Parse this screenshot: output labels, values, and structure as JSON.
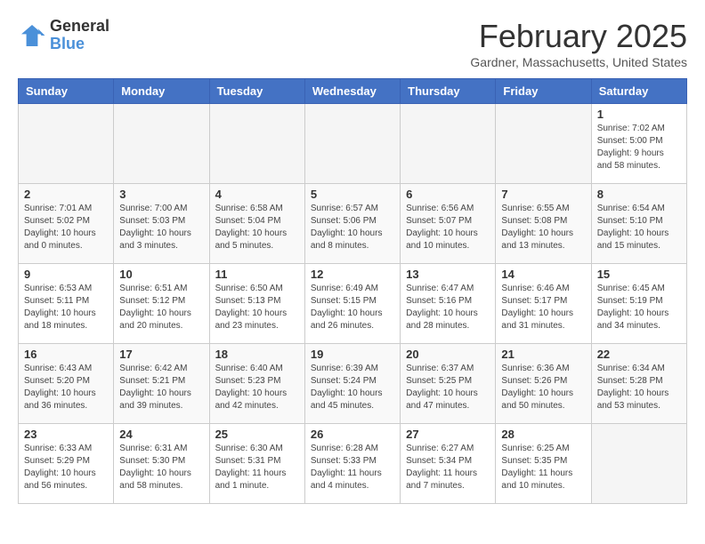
{
  "header": {
    "logo_general": "General",
    "logo_blue": "Blue",
    "title": "February 2025",
    "subtitle": "Gardner, Massachusetts, United States"
  },
  "weekdays": [
    "Sunday",
    "Monday",
    "Tuesday",
    "Wednesday",
    "Thursday",
    "Friday",
    "Saturday"
  ],
  "weeks": [
    [
      {
        "day": "",
        "info": ""
      },
      {
        "day": "",
        "info": ""
      },
      {
        "day": "",
        "info": ""
      },
      {
        "day": "",
        "info": ""
      },
      {
        "day": "",
        "info": ""
      },
      {
        "day": "",
        "info": ""
      },
      {
        "day": "1",
        "info": "Sunrise: 7:02 AM\nSunset: 5:00 PM\nDaylight: 9 hours\nand 58 minutes."
      }
    ],
    [
      {
        "day": "2",
        "info": "Sunrise: 7:01 AM\nSunset: 5:02 PM\nDaylight: 10 hours\nand 0 minutes."
      },
      {
        "day": "3",
        "info": "Sunrise: 7:00 AM\nSunset: 5:03 PM\nDaylight: 10 hours\nand 3 minutes."
      },
      {
        "day": "4",
        "info": "Sunrise: 6:58 AM\nSunset: 5:04 PM\nDaylight: 10 hours\nand 5 minutes."
      },
      {
        "day": "5",
        "info": "Sunrise: 6:57 AM\nSunset: 5:06 PM\nDaylight: 10 hours\nand 8 minutes."
      },
      {
        "day": "6",
        "info": "Sunrise: 6:56 AM\nSunset: 5:07 PM\nDaylight: 10 hours\nand 10 minutes."
      },
      {
        "day": "7",
        "info": "Sunrise: 6:55 AM\nSunset: 5:08 PM\nDaylight: 10 hours\nand 13 minutes."
      },
      {
        "day": "8",
        "info": "Sunrise: 6:54 AM\nSunset: 5:10 PM\nDaylight: 10 hours\nand 15 minutes."
      }
    ],
    [
      {
        "day": "9",
        "info": "Sunrise: 6:53 AM\nSunset: 5:11 PM\nDaylight: 10 hours\nand 18 minutes."
      },
      {
        "day": "10",
        "info": "Sunrise: 6:51 AM\nSunset: 5:12 PM\nDaylight: 10 hours\nand 20 minutes."
      },
      {
        "day": "11",
        "info": "Sunrise: 6:50 AM\nSunset: 5:13 PM\nDaylight: 10 hours\nand 23 minutes."
      },
      {
        "day": "12",
        "info": "Sunrise: 6:49 AM\nSunset: 5:15 PM\nDaylight: 10 hours\nand 26 minutes."
      },
      {
        "day": "13",
        "info": "Sunrise: 6:47 AM\nSunset: 5:16 PM\nDaylight: 10 hours\nand 28 minutes."
      },
      {
        "day": "14",
        "info": "Sunrise: 6:46 AM\nSunset: 5:17 PM\nDaylight: 10 hours\nand 31 minutes."
      },
      {
        "day": "15",
        "info": "Sunrise: 6:45 AM\nSunset: 5:19 PM\nDaylight: 10 hours\nand 34 minutes."
      }
    ],
    [
      {
        "day": "16",
        "info": "Sunrise: 6:43 AM\nSunset: 5:20 PM\nDaylight: 10 hours\nand 36 minutes."
      },
      {
        "day": "17",
        "info": "Sunrise: 6:42 AM\nSunset: 5:21 PM\nDaylight: 10 hours\nand 39 minutes."
      },
      {
        "day": "18",
        "info": "Sunrise: 6:40 AM\nSunset: 5:23 PM\nDaylight: 10 hours\nand 42 minutes."
      },
      {
        "day": "19",
        "info": "Sunrise: 6:39 AM\nSunset: 5:24 PM\nDaylight: 10 hours\nand 45 minutes."
      },
      {
        "day": "20",
        "info": "Sunrise: 6:37 AM\nSunset: 5:25 PM\nDaylight: 10 hours\nand 47 minutes."
      },
      {
        "day": "21",
        "info": "Sunrise: 6:36 AM\nSunset: 5:26 PM\nDaylight: 10 hours\nand 50 minutes."
      },
      {
        "day": "22",
        "info": "Sunrise: 6:34 AM\nSunset: 5:28 PM\nDaylight: 10 hours\nand 53 minutes."
      }
    ],
    [
      {
        "day": "23",
        "info": "Sunrise: 6:33 AM\nSunset: 5:29 PM\nDaylight: 10 hours\nand 56 minutes."
      },
      {
        "day": "24",
        "info": "Sunrise: 6:31 AM\nSunset: 5:30 PM\nDaylight: 10 hours\nand 58 minutes."
      },
      {
        "day": "25",
        "info": "Sunrise: 6:30 AM\nSunset: 5:31 PM\nDaylight: 11 hours\nand 1 minute."
      },
      {
        "day": "26",
        "info": "Sunrise: 6:28 AM\nSunset: 5:33 PM\nDaylight: 11 hours\nand 4 minutes."
      },
      {
        "day": "27",
        "info": "Sunrise: 6:27 AM\nSunset: 5:34 PM\nDaylight: 11 hours\nand 7 minutes."
      },
      {
        "day": "28",
        "info": "Sunrise: 6:25 AM\nSunset: 5:35 PM\nDaylight: 11 hours\nand 10 minutes."
      },
      {
        "day": "",
        "info": ""
      }
    ]
  ]
}
